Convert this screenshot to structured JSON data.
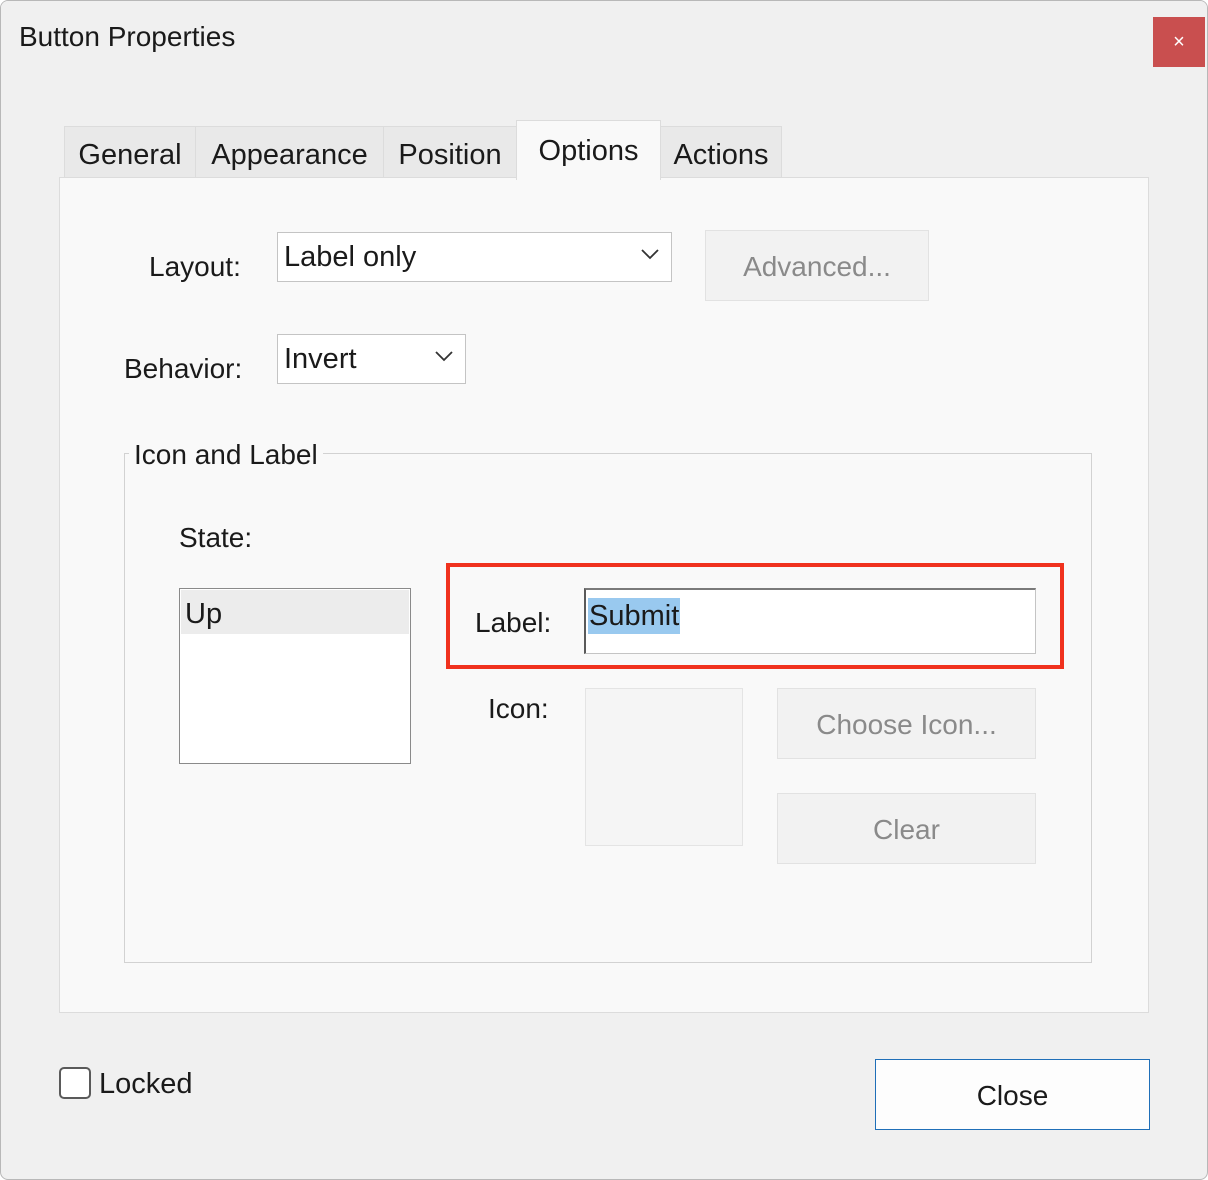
{
  "window": {
    "title": "Button Properties",
    "close_glyph": "×"
  },
  "tabs": [
    {
      "label": "General",
      "active": false
    },
    {
      "label": "Appearance",
      "active": false
    },
    {
      "label": "Position",
      "active": false
    },
    {
      "label": "Options",
      "active": true
    },
    {
      "label": "Actions",
      "active": false
    }
  ],
  "options": {
    "layout_label": "Layout:",
    "layout_value": "Label only",
    "advanced_label": "Advanced...",
    "behavior_label": "Behavior:",
    "behavior_value": "Invert",
    "group_title": "Icon and Label",
    "state_label": "State:",
    "state_items": [
      "Up"
    ],
    "label_field_label": "Label:",
    "label_field_value": "Submit",
    "icon_label": "Icon:",
    "choose_icon_label": "Choose Icon...",
    "clear_label": "Clear"
  },
  "footer": {
    "locked_label": "Locked",
    "locked_checked": false,
    "close_label": "Close"
  },
  "colors": {
    "title_close_bg": "#c94f4f",
    "highlight_border": "#f0321e",
    "selection": "#99c9ef",
    "default_button_border": "#1f6fb8"
  }
}
